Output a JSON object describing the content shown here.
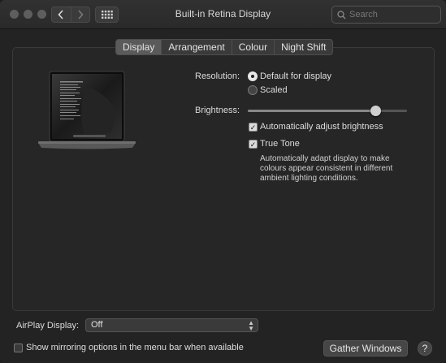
{
  "window": {
    "title": "Built-in Retina Display"
  },
  "search": {
    "placeholder": "Search"
  },
  "tabs": [
    {
      "label": "Display",
      "selected": true
    },
    {
      "label": "Arrangement"
    },
    {
      "label": "Colour"
    },
    {
      "label": "Night Shift"
    }
  ],
  "resolution": {
    "label": "Resolution:",
    "options": [
      {
        "label": "Default for display",
        "selected": true
      },
      {
        "label": "Scaled",
        "selected": false
      }
    ]
  },
  "brightness": {
    "label": "Brightness:",
    "level": 0.8,
    "auto_label": "Automatically adjust brightness",
    "auto_checked": true
  },
  "true_tone": {
    "label": "True Tone",
    "checked": true,
    "description": "Automatically adapt display to make colours appear consistent in different ambient lighting conditions."
  },
  "airplay": {
    "label": "AirPlay Display:",
    "value": "Off"
  },
  "mirroring": {
    "label": "Show mirroring options in the menu bar when available",
    "checked": false
  },
  "buttons": {
    "gather": "Gather Windows",
    "help": "?"
  },
  "icons": {
    "back": "chevron-left-icon",
    "forward": "chevron-right-icon",
    "grid": "grid-icon",
    "search": "search-icon"
  }
}
